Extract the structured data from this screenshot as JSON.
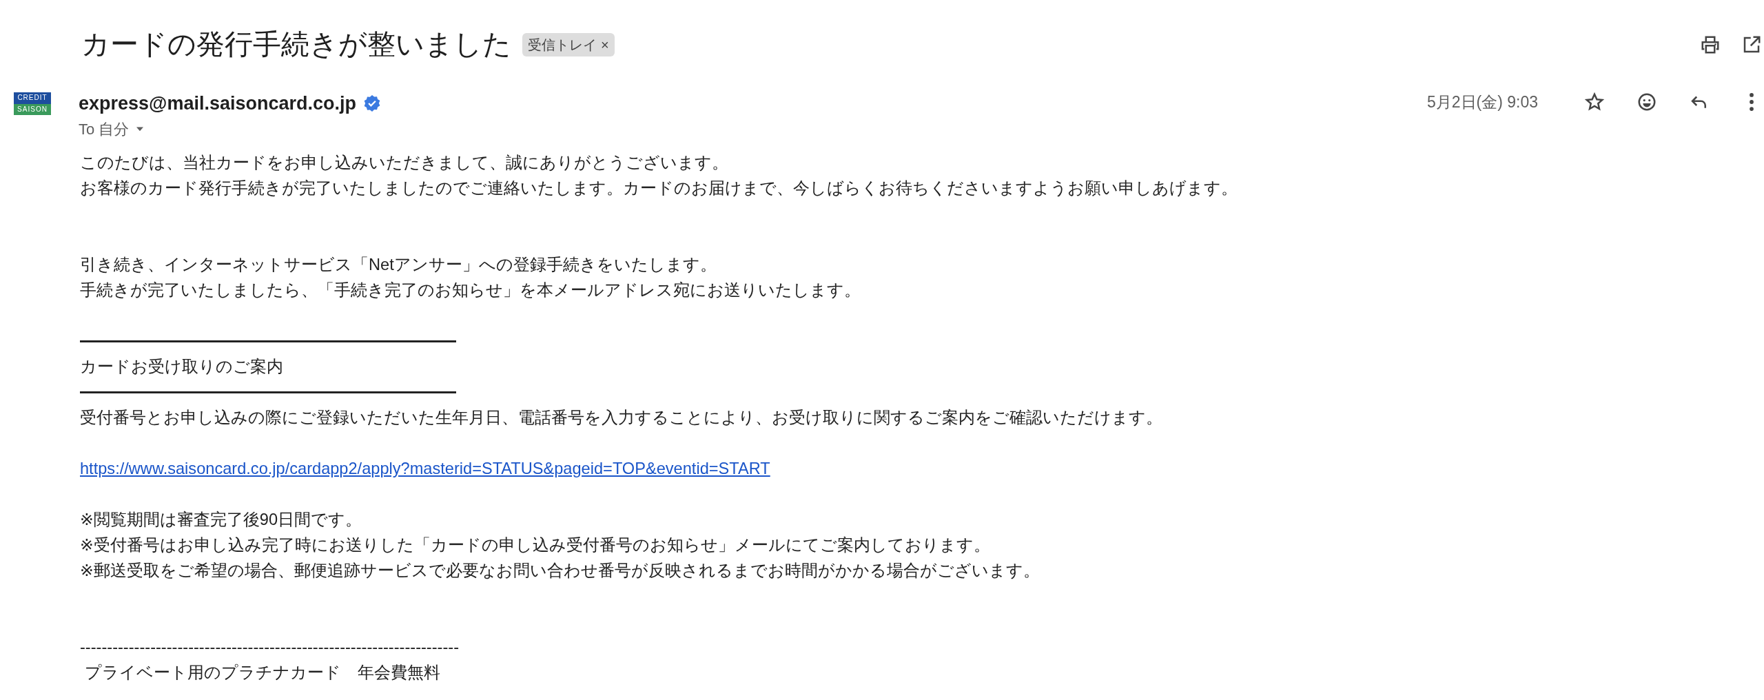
{
  "subject": "カードの発行手続きが整いました",
  "label": {
    "text": "受信トレイ",
    "close": "×"
  },
  "sender": {
    "address": "express@mail.saisoncard.co.jp",
    "verified": true,
    "logo": [
      "CREDIT",
      "SAISON"
    ]
  },
  "recipient": "To 自分",
  "date": "5月2日(金) 9:03",
  "starred": false,
  "body": [
    {
      "kind": "text",
      "text": "このたびは、当社カードをお申し込みいただきまして、誠にありがとうございます。"
    },
    {
      "kind": "text",
      "text": "お客様のカード発行手続きが完了いたしましたのでご連絡いたします。カードのお届けまで、今しばらくお待ちくださいますようお願い申しあげます。"
    },
    {
      "kind": "blank"
    },
    {
      "kind": "blank"
    },
    {
      "kind": "text",
      "text": "引き続き、インターネットサービス「Netアンサー」への登録手続きをいたします。"
    },
    {
      "kind": "text",
      "text": "手続きが完了いたしましたら、「手続き完了のお知らせ」を本メールアドレス宛にお送りいたします。"
    },
    {
      "kind": "blank"
    },
    {
      "kind": "rule"
    },
    {
      "kind": "text",
      "text": "カードお受け取りのご案内"
    },
    {
      "kind": "rule"
    },
    {
      "kind": "text",
      "text": "受付番号とお申し込みの際にご登録いただいた生年月日、電話番号を入力することにより、お受け取りに関するご案内をご確認いただけます。"
    },
    {
      "kind": "blank"
    },
    {
      "kind": "link",
      "text": "https://www.saisoncard.co.jp/cardapp2/apply?masterid=STATUS&pageid=TOP&eventid=START"
    },
    {
      "kind": "blank"
    },
    {
      "kind": "text",
      "text": "※閲覧期間は審査完了後90日間です。"
    },
    {
      "kind": "text",
      "text": "※受付番号はお申し込み完了時にお送りした「カードの申し込み受付番号のお知らせ」メールにてご案内しております。"
    },
    {
      "kind": "text",
      "text": "※郵送受取をご希望の場合、郵便追跡サービスで必要なお問い合わせ番号が反映されるまでお時間がかかる場合がございます。"
    },
    {
      "kind": "blank"
    },
    {
      "kind": "blank"
    },
    {
      "kind": "text",
      "text": "----------------------------------------------------------------------"
    },
    {
      "kind": "text",
      "text": " プライベート用のプラチナカード　年会費無料"
    }
  ]
}
